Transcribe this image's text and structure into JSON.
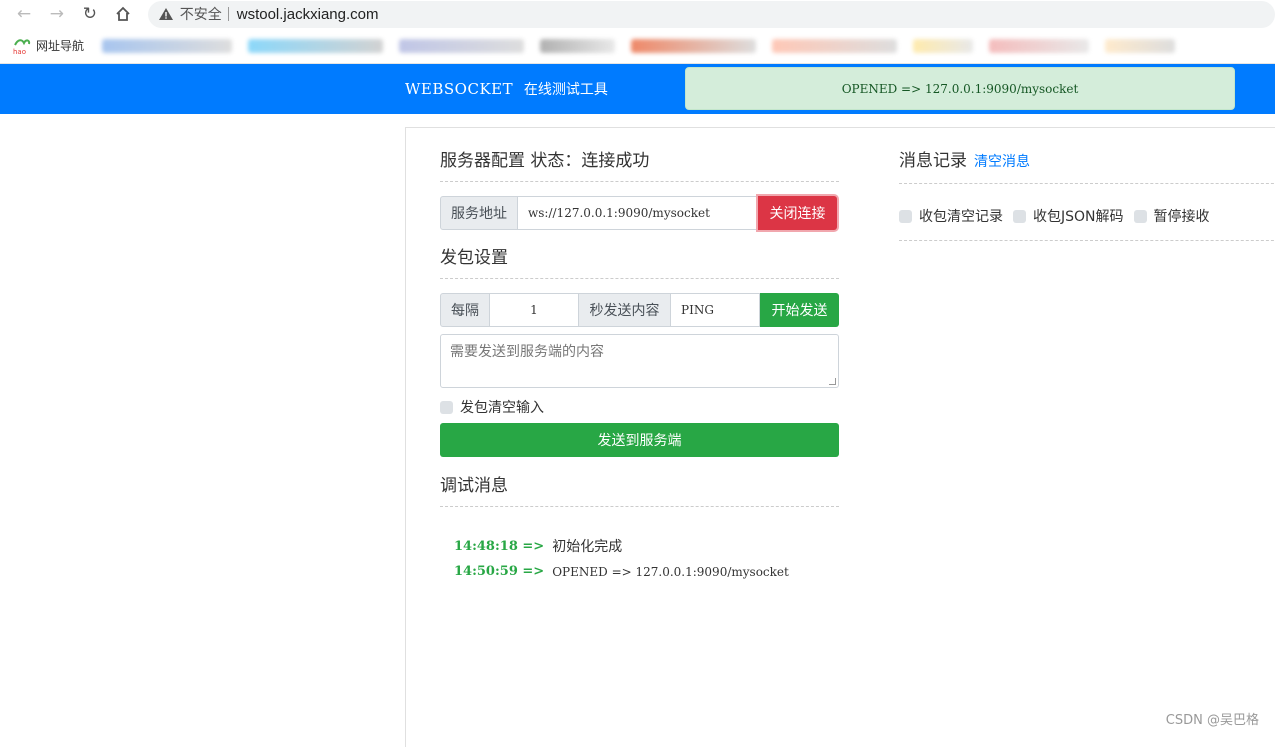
{
  "browser": {
    "security_label": "不安全",
    "url": "wstool.jackxiang.com",
    "bookmarks": [
      {
        "label": "网址导航"
      }
    ]
  },
  "header": {
    "brand_en": "WEBSOCKET",
    "brand_cn": "在线测试工具",
    "status": "OPENED => 127.0.0.1:9090/mysocket"
  },
  "server_config": {
    "title": "服务器配置 状态：连接成功",
    "addr_label": "服务地址",
    "addr_value": "ws://127.0.0.1:9090/mysocket",
    "close_btn": "关闭连接"
  },
  "send_settings": {
    "title": "发包设置",
    "every_label": "每隔",
    "interval_value": "1",
    "seconds_label": "秒发送内容",
    "content_value": "PING",
    "start_btn": "开始发送",
    "textarea_placeholder": "需要发送到服务端的内容",
    "clear_input_label": "发包清空输入",
    "send_btn": "发送到服务端"
  },
  "debug": {
    "title": "调试消息",
    "logs": [
      {
        "time": "14:48:18",
        "arrow": "=>",
        "msg": "初始化完成"
      },
      {
        "time": "14:50:59",
        "arrow": "=>",
        "msg": "OPENED => 127.0.0.1:9090/mysocket"
      }
    ]
  },
  "messages": {
    "title": "消息记录",
    "clear_link": "清空消息",
    "options": [
      "收包清空记录",
      "收包JSON解码",
      "暂停接收"
    ]
  },
  "watermark": "CSDN @吴巴格",
  "colors": {
    "primary": "#007bff",
    "success": "#28a745",
    "danger": "#dc3545",
    "alert_bg": "#d4edda"
  }
}
